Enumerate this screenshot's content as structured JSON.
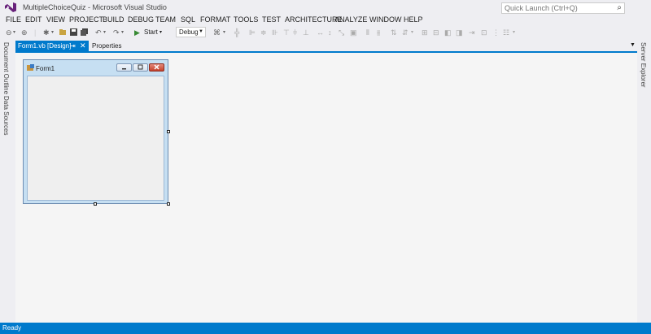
{
  "window": {
    "title": "MultipleChoiceQuiz - Microsoft Visual Studio"
  },
  "quick_launch": {
    "placeholder": "Quick Launch (Ctrl+Q)"
  },
  "menu": [
    "FILE",
    "EDIT",
    "VIEW",
    "PROJECT",
    "BUILD",
    "DEBUG",
    "TEAM",
    "SQL",
    "FORMAT",
    "TOOLS",
    "TEST",
    "ARCHITECTURE",
    "ANALYZE",
    "WINDOW",
    "HELP"
  ],
  "toolbar": {
    "start_label": "Start",
    "configuration": "Debug"
  },
  "left_tabs": [
    "Document Outline",
    "Data Sources"
  ],
  "right_tabs": [
    "Server Explorer"
  ],
  "doc_tabs": {
    "active": "Form1.vb [Design]",
    "second": "Properties"
  },
  "form": {
    "caption": "Form1"
  },
  "status": {
    "text": "Ready"
  },
  "colors": {
    "accent": "#007acc",
    "chrome": "#eeeef2",
    "designer_bg": "#f5f5f5"
  }
}
